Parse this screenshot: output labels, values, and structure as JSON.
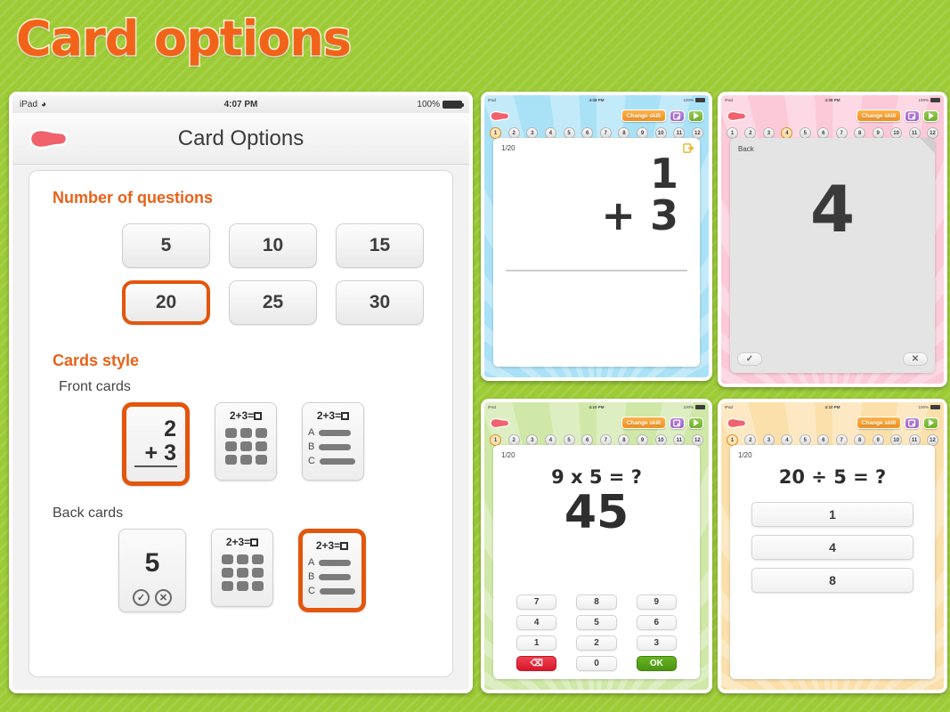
{
  "page": {
    "title": "Card options"
  },
  "main_device": {
    "status": {
      "device": "iPad",
      "wifi_icon": "wifi-icon",
      "time": "4:07 PM",
      "battery_pct": "100%"
    },
    "nav": {
      "back_icon": "back-arrow-icon",
      "title": "Card Options"
    },
    "sections": {
      "questions": {
        "heading": "Number of questions",
        "options": [
          "5",
          "10",
          "15",
          "20",
          "25",
          "30"
        ],
        "selected": "20"
      },
      "cards_style": {
        "heading": "Cards style",
        "front": {
          "label": "Front cards",
          "selected_index": 0,
          "options": [
            {
              "kind": "sum",
              "top": "2",
              "bottom": "+ 3"
            },
            {
              "kind": "grid",
              "equation": "2+3="
            },
            {
              "kind": "choices",
              "equation": "2+3=",
              "rows": [
                "A",
                "B",
                "C"
              ]
            }
          ]
        },
        "back": {
          "label": "Back cards",
          "selected_index": 2,
          "options": [
            {
              "kind": "answer",
              "value": "5",
              "ok_icon": "check-circle-icon",
              "no_icon": "cross-circle-icon"
            },
            {
              "kind": "grid",
              "equation": "2+3="
            },
            {
              "kind": "choices",
              "equation": "2+3=",
              "rows": [
                "A",
                "B",
                "C"
              ]
            }
          ]
        }
      }
    }
  },
  "previews": {
    "blue": {
      "theme_color": "#a9e1f6",
      "status": {
        "device": "iPad",
        "time": "4:08 PM",
        "battery_pct": "100%"
      },
      "toolbar": {
        "back_icon": "back-arrow-icon",
        "change_skill": "Change skill",
        "settings_icon": "settings-icon",
        "play_icon": "play-icon"
      },
      "tabs": [
        "1",
        "2",
        "3",
        "4",
        "5",
        "6",
        "7",
        "8",
        "9",
        "10",
        "11",
        "12"
      ],
      "active_tab": "1",
      "card": {
        "counter": "1/20",
        "flip_icon": "flip-card-icon",
        "sum_top": "1",
        "sum_bottom": "+ 3"
      }
    },
    "pink": {
      "theme_color": "#fbc9d8",
      "status": {
        "device": "iPad",
        "time": "4:08 PM",
        "battery_pct": "100%"
      },
      "toolbar": {
        "back_icon": "back-arrow-icon",
        "change_skill": "Change skill",
        "settings_icon": "settings-icon",
        "play_icon": "play-icon"
      },
      "tabs": [
        "1",
        "2",
        "3",
        "4",
        "5",
        "6",
        "7",
        "8",
        "9",
        "10",
        "11",
        "12"
      ],
      "active_tab": "4",
      "card": {
        "label": "Back",
        "peel_icon": "page-peel-icon",
        "answer": "4",
        "ok_icon": "✓",
        "no_icon": "✕"
      }
    },
    "green": {
      "theme_color": "#cfe8a7",
      "status": {
        "device": "iPad",
        "time": "4:10 PM",
        "battery_pct": "100%"
      },
      "toolbar": {
        "back_icon": "back-arrow-icon",
        "change_skill": "Change skill",
        "settings_icon": "settings-icon",
        "play_icon": "play-icon"
      },
      "tabs": [
        "1",
        "2",
        "3",
        "4",
        "5",
        "6",
        "7",
        "8",
        "9",
        "10",
        "11",
        "12"
      ],
      "active_tab": "1",
      "card": {
        "counter": "1/20",
        "equation": "9 x 5 = ?",
        "answer": "45"
      },
      "keypad": [
        "7",
        "8",
        "9",
        "4",
        "5",
        "6",
        "1",
        "2",
        "3",
        "⌫",
        "0",
        "OK"
      ]
    },
    "orange": {
      "theme_color": "#fbe0ab",
      "status": {
        "device": "iPad",
        "time": "4:10 PM",
        "battery_pct": "100%"
      },
      "toolbar": {
        "back_icon": "back-arrow-icon",
        "change_skill": "Change skill",
        "settings_icon": "settings-icon",
        "play_icon": "play-icon"
      },
      "tabs": [
        "1",
        "2",
        "3",
        "4",
        "5",
        "6",
        "7",
        "8",
        "9",
        "10",
        "11",
        "12"
      ],
      "active_tab": "1",
      "card": {
        "counter": "1/20",
        "equation": "20 ÷ 5 = ?",
        "choices": [
          "1",
          "4",
          "8"
        ]
      }
    }
  },
  "colors": {
    "accent_orange": "#e2560d",
    "heading_orange": "#e8621a",
    "background_green": "#9ccb35"
  }
}
